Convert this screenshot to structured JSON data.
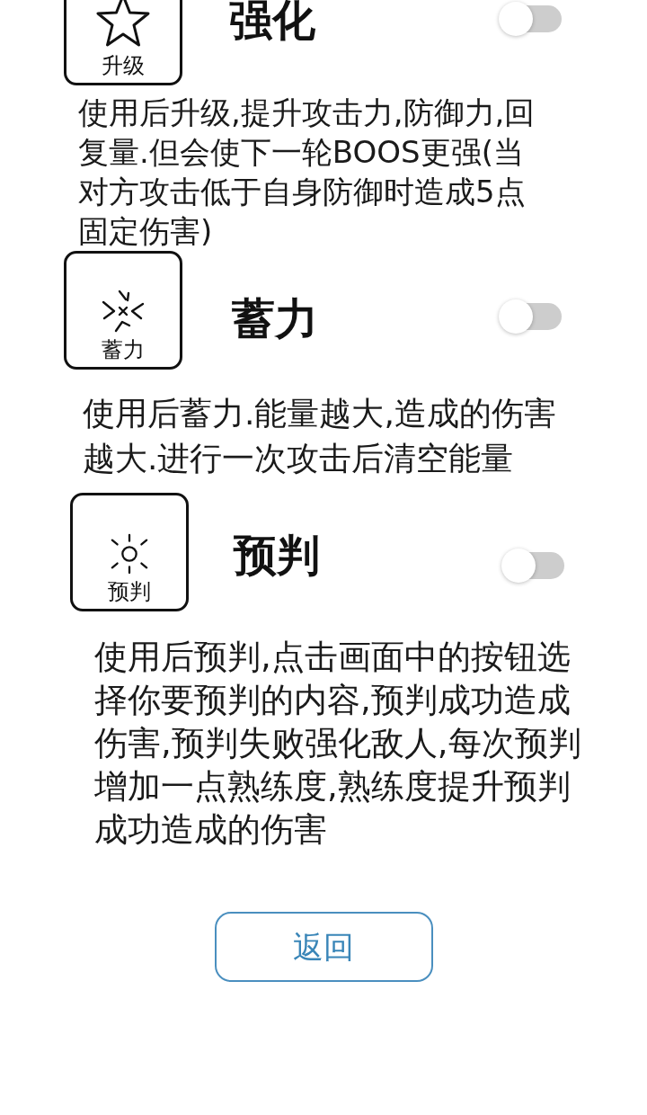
{
  "skills": [
    {
      "kind": "star",
      "badge_label": "升级",
      "title": "强化",
      "on": false,
      "description": "使用后升级,提升攻击力,防御力,回复量.但会使下一轮BOOS更强(当对方攻击低于自身防御时造成5点固定伤害)"
    },
    {
      "kind": "burst",
      "badge_label": "蓄力",
      "title": "蓄力",
      "on": false,
      "description": "使用后蓄力.能量越大,造成的伤害越大.进行一次攻击后清空能量"
    },
    {
      "kind": "sun",
      "badge_label": "预判",
      "title": "预判",
      "on": false,
      "description": "使用后预判,点击画面中的按钮选择你要预判的内容,预判成功造成伤害,预判失败强化敌人,每次预判增加一点熟练度,熟练度提升预判成功造成的伤害"
    }
  ],
  "back_button": {
    "label": "返回"
  }
}
